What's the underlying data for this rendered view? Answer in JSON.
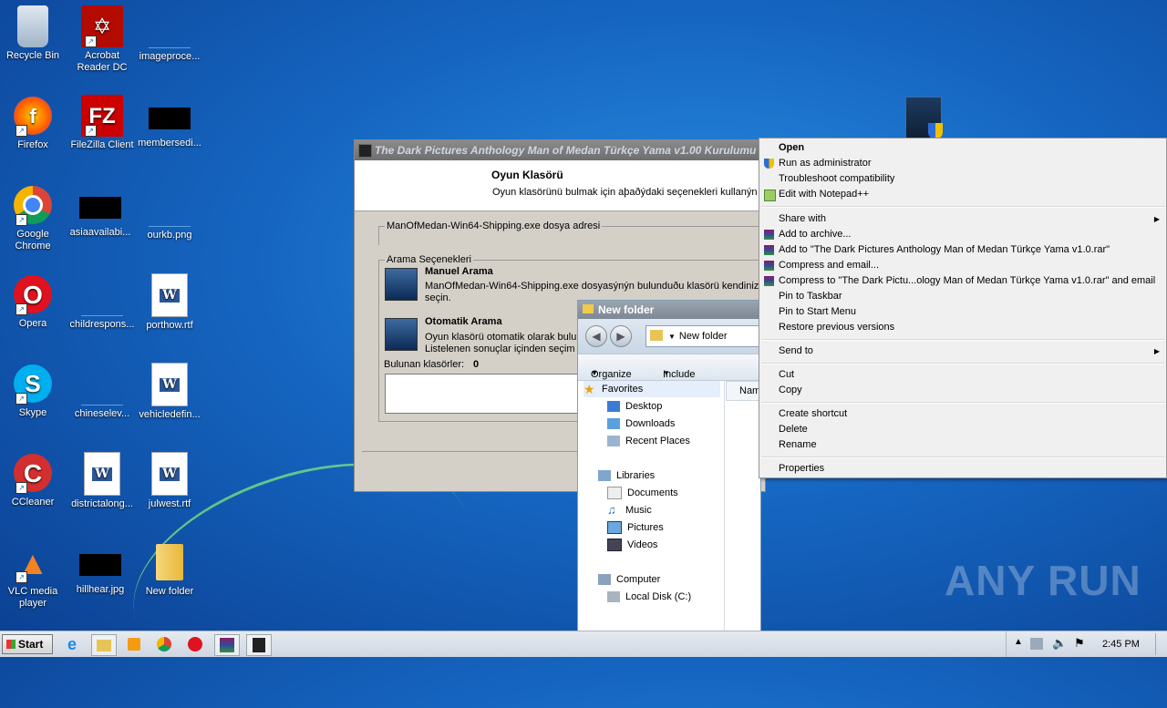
{
  "desktop": {
    "icons": [
      {
        "label": "Recycle Bin"
      },
      {
        "label": "Acrobat Reader DC"
      },
      {
        "label": "imageproce..."
      },
      {
        "label": "Firefox"
      },
      {
        "label": "FileZilla Client"
      },
      {
        "label": "membersedi..."
      },
      {
        "label": "Google Chrome"
      },
      {
        "label": "asiaavailabi..."
      },
      {
        "label": "ourkb.png"
      },
      {
        "label": "Opera"
      },
      {
        "label": "childrespons..."
      },
      {
        "label": "porthow.rtf"
      },
      {
        "label": "Skype"
      },
      {
        "label": "chineselev..."
      },
      {
        "label": "vehicledefin..."
      },
      {
        "label": "CCleaner"
      },
      {
        "label": "districtalong..."
      },
      {
        "label": "julwest.rtf"
      },
      {
        "label": "VLC media player"
      },
      {
        "label": "hillhear.jpg"
      },
      {
        "label": "New folder"
      }
    ]
  },
  "installer": {
    "title": "The Dark Pictures Anthology Man of Medan Türkçe Yama v1.00 Kurulumu",
    "header_title": "Oyun Klasörü",
    "header_subtitle": "Oyun klasörünü bulmak için aþaðýdaki seçenekleri kullanýn",
    "exe_group_label": "ManOfMedan-Win64-Shipping.exe dosya adresi",
    "search_group_label": "Arama Seçenekleri",
    "manual_title": "Manuel Arama",
    "manual_desc": "ManOfMedan-Win64-Shipping.exe dosyasýnýn bulunduðu klasörü kendiniz seçin.",
    "auto_title": "Otomatik Arama",
    "auto_desc_1": "Oyun klasörü otomatik olarak bulun",
    "auto_desc_2": "Listelenen sonuçlar içinden seçim y",
    "found_label": "Bulunan klasörler:",
    "found_count": "0"
  },
  "explorer": {
    "title": "New folder",
    "address": "New folder",
    "organize": "Organize",
    "include_in_library": "Include in library",
    "column_name": "Nam",
    "tree": {
      "favorites": "Favorites",
      "desktop": "Desktop",
      "downloads": "Downloads",
      "recent_places": "Recent Places",
      "libraries": "Libraries",
      "documents": "Documents",
      "music": "Music",
      "pictures": "Pictures",
      "videos": "Videos",
      "computer": "Computer",
      "local_disk": "Local Disk (C:)"
    }
  },
  "context_menu": {
    "open": "Open",
    "run_as_admin": "Run as administrator",
    "troubleshoot": "Troubleshoot compatibility",
    "edit_notepad": "Edit with Notepad++",
    "share_with": "Share with",
    "add_archive": "Add to archive...",
    "add_to_rar": "Add to \"The Dark Pictures Anthology Man of Medan Türkçe Yama v1.0.rar\"",
    "compress_email": "Compress and email...",
    "compress_rar_email": "Compress to \"The Dark Pictu...ology Man of Medan Türkçe Yama v1.0.rar\" and email",
    "pin_taskbar": "Pin to Taskbar",
    "pin_start": "Pin to Start Menu",
    "restore_versions": "Restore previous versions",
    "send_to": "Send to",
    "cut": "Cut",
    "copy": "Copy",
    "create_shortcut": "Create shortcut",
    "delete": "Delete",
    "rename": "Rename",
    "properties": "Properties"
  },
  "taskbar": {
    "start_label": "Start",
    "clock": "2:45 PM"
  },
  "watermark": "ANY RUN",
  "colors": {
    "desktop_blue": "#1565c0",
    "menu_bg": "#f0f0f0"
  }
}
